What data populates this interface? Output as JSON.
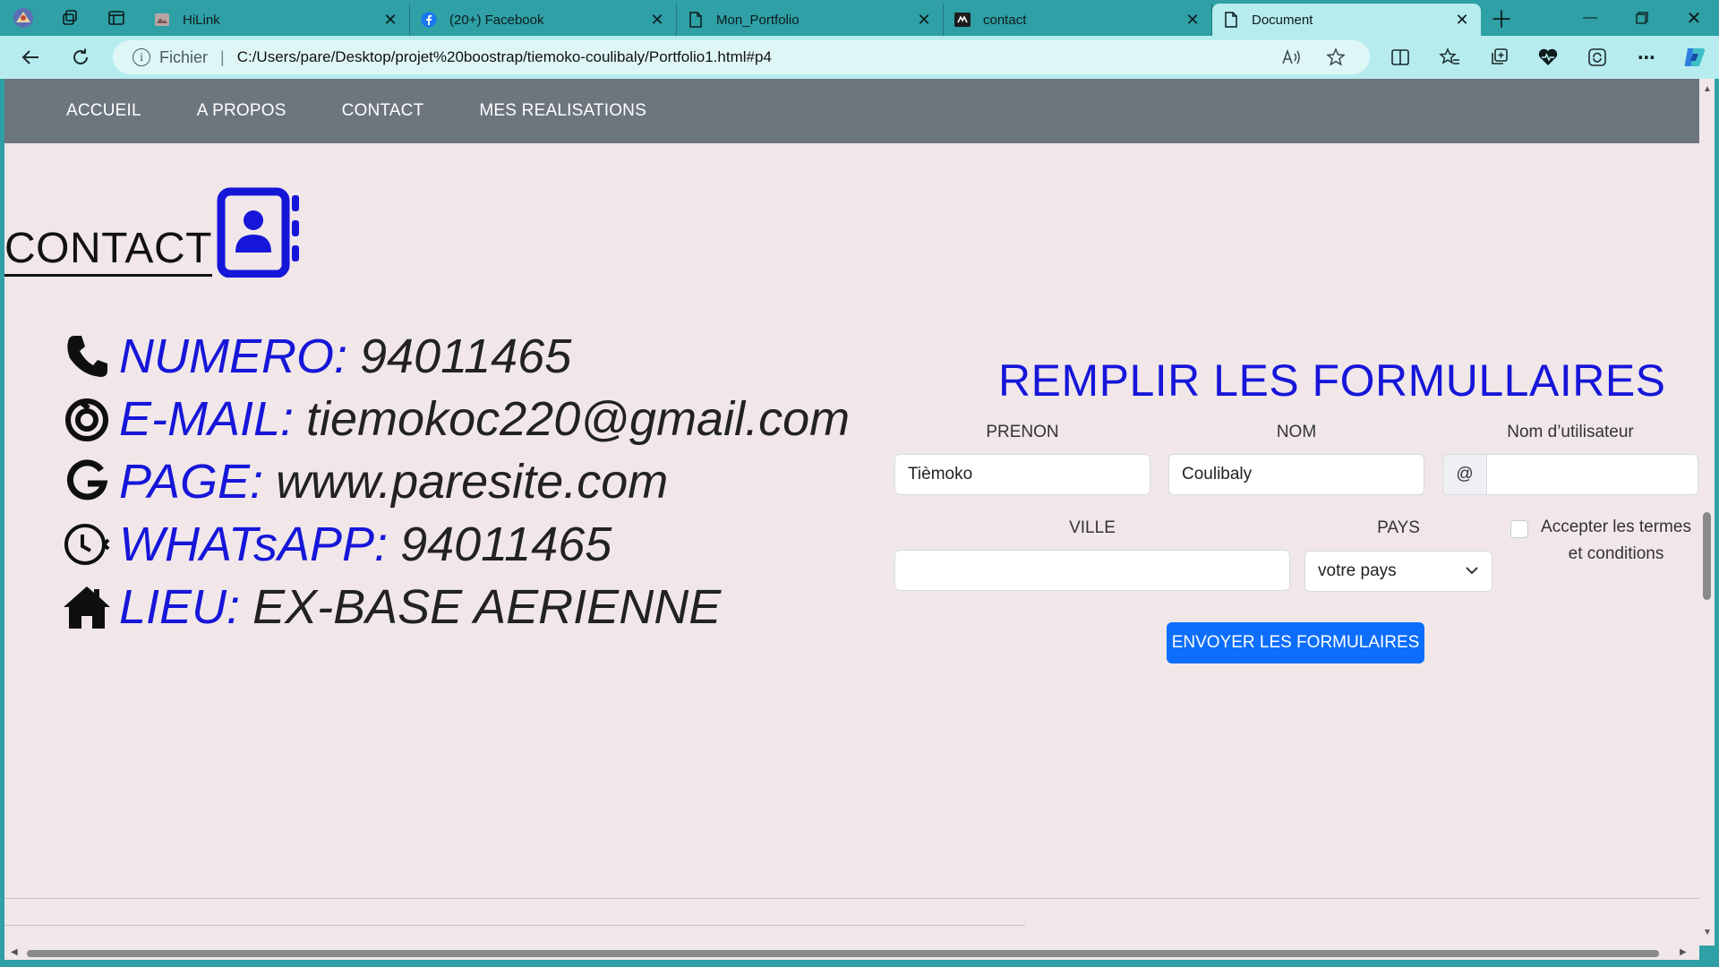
{
  "tabs": [
    {
      "title": "HiLink",
      "favicon": "hilink-icon"
    },
    {
      "title": "(20+) Facebook",
      "favicon": "facebook-icon"
    },
    {
      "title": "Mon_Portfolio",
      "favicon": "page-icon"
    },
    {
      "title": "contact",
      "favicon": "contact-icon"
    },
    {
      "title": "Document",
      "favicon": "page-icon",
      "active": true
    }
  ],
  "addressbar": {
    "scheme_label": "Fichier",
    "url": "C:/Users/pare/Desktop/projet%20boostrap/tiemoko-coulibaly/Portfolio1.html#p4"
  },
  "nav": {
    "items": [
      "ACCUEIL",
      "A PROPOS",
      "CONTACT",
      "MES REALISATIONS"
    ]
  },
  "contact": {
    "heading": "CONTACT",
    "rows": [
      {
        "icon": "phone-icon",
        "label": "NUMERO:",
        "value": "94011465"
      },
      {
        "icon": "email-icon",
        "label": "E-MAIL:",
        "value": "tiemokoc220@gmail.com"
      },
      {
        "icon": "google-icon",
        "label": "PAGE:",
        "value": "www.paresite.com"
      },
      {
        "icon": "whatsapp-icon",
        "label": "WHATsAPP:",
        "value": "94011465"
      },
      {
        "icon": "home-icon",
        "label": "LIEU:",
        "value": "EX-BASE AERIENNE"
      }
    ]
  },
  "form": {
    "title": "REMPLIR LES FORMULLAIRES",
    "prenom_label": "PRENON",
    "prenom_value": "Tièmoko",
    "nom_label": "NOM",
    "nom_value": "Coulibaly",
    "username_label": "Nom d’utilisateur",
    "username_prefix": "@",
    "username_value": "",
    "ville_label": "VILLE",
    "ville_value": "",
    "pays_label": "PAYS",
    "pays_selected": "votre pays",
    "terms_label": "Accepter les termes et conditions",
    "terms_checked": false,
    "submit_label": "ENVOYER LES FORMULAIRES"
  },
  "colors": {
    "accent_blue": "#1616d9",
    "button_blue": "#0d6efd",
    "navbar": "#6d757f",
    "page_bg": "#f1e7e9",
    "browser_frame": "#2ea0a6"
  }
}
